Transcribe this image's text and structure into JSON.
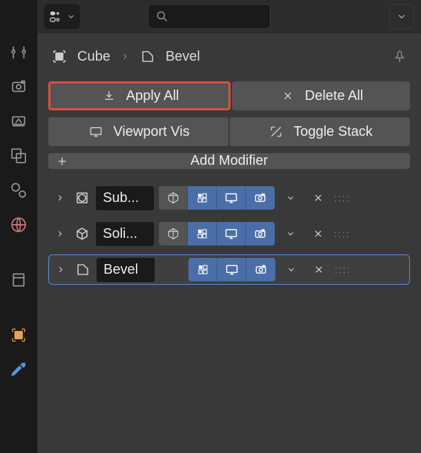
{
  "breadcrumb": {
    "object_name": "Cube",
    "modifier_name": "Bevel"
  },
  "buttons": {
    "apply_all": "Apply All",
    "delete_all": "Delete All",
    "viewport_vis": "Viewport Vis",
    "toggle_stack": "Toggle Stack",
    "add_modifier": "Add Modifier"
  },
  "modifiers": [
    {
      "type": "subsurf",
      "name": "Sub...",
      "edit_on": false,
      "selected": false
    },
    {
      "type": "solidify",
      "name": "Soli...",
      "edit_on": false,
      "selected": false
    },
    {
      "type": "bevel",
      "name": "Bevel",
      "edit_on": false,
      "selected": true
    }
  ],
  "colors": {
    "highlight": "#e84c3d",
    "accent": "#4a6fa8",
    "active_tab": "#5b8fe0"
  }
}
